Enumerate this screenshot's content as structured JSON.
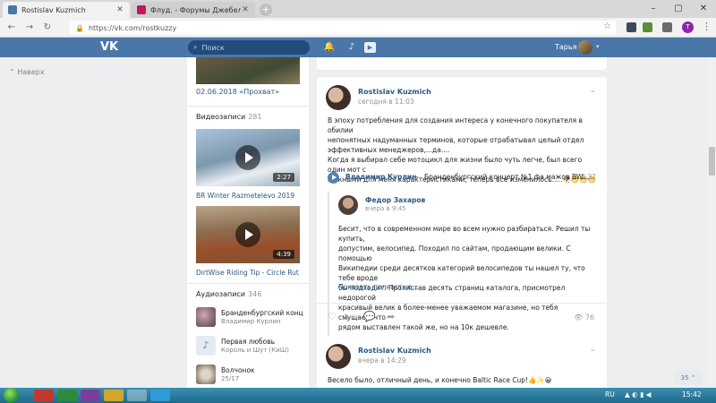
{
  "browser": {
    "tabs": [
      {
        "title": "Rostislav Kuzmich",
        "favicon_color": "#4a76a8"
      },
      {
        "title": "Флуд. - Форумы Джебел-клуба",
        "favicon_color": "#c2185b"
      }
    ],
    "url": "https://vk.com/rostkuzzy",
    "profile_initial": "T"
  },
  "header": {
    "search_placeholder": "Поиск",
    "user_name": "Тарья"
  },
  "nav": {
    "back_label": "Наверх"
  },
  "sidebar": {
    "photo_caption": "02.06.2018 «Прохват»",
    "videos_header": "Видеозаписи",
    "videos_count": "281",
    "videos": [
      {
        "title": "BR Winter Razmetelevo 2019",
        "duration": "2:27"
      },
      {
        "title": "DirtWise Riding Tip - Circle Rut",
        "duration": "4:39"
      }
    ],
    "audio_header": "Аудиозаписи",
    "audio_count": "346",
    "audio": [
      {
        "title": "Бранденбургский конце...",
        "artist": "Владимир Курлин"
      },
      {
        "title": "Первая любовь",
        "artist": "Король и Шут (КиШ)"
      },
      {
        "title": "Волчонок",
        "artist": "25/17"
      }
    ]
  },
  "posts": [
    {
      "author": "Rostislav Kuzmich",
      "date": "сегодня в 11:03",
      "text_lines": [
        "В эпоху потребления для создания интереса у конечного покупателя в обилии",
        "непонятных надуманных терминов, которые отрабатывал целый отдел",
        "эффективных менеджеров,...да....",
        "Когда я выбирал себе мотоцикл для жизни было чуть легче, был всего один мот с",
        "нужными для меня характеристиками, теперь все изменилось.....🥀😬😬😬"
      ],
      "audio": {
        "artist": "Владимир Курлин",
        "dash": "–",
        "track": "Бранденбургский концерт №1 фа мажор BW...",
        "duration": "4:32"
      },
      "repost": {
        "author": "Федор Захаров",
        "date": "вчера в 9:45",
        "text_lines": [
          "Бесит, что в современном мире во всем нужно разбираться. Решил ты купить,",
          "допустим, велосипед. Походил по сайтам, продающим велики. С помощью",
          "Википедии среди десятков категорий велосипедов ты нашел ту, что тебе вроде",
          "бы подходит. Пролистав десять страниц каталога, присмотрел недорогой",
          "красивый велик в более-менее уважаемом магазине, но тебя смущает, что",
          "рядом выставлен такой же, но на 10к дешевле."
        ],
        "more_label": "Показать полностью..."
      },
      "likes": "3",
      "views": "76"
    },
    {
      "author": "Rostislav Kuzmich",
      "date": "вчера в 14:29",
      "text_lines": [
        "Весело было, отличный день, и конечно Baltic Race Cup!👍✨😀"
      ]
    }
  ],
  "chat_badge": "35",
  "taskbar": {
    "lang": "RU",
    "time": "15:42"
  },
  "colors": {
    "vk_blue": "#4a76a8",
    "link": "#2a5885",
    "page_bg": "#edeef0"
  }
}
